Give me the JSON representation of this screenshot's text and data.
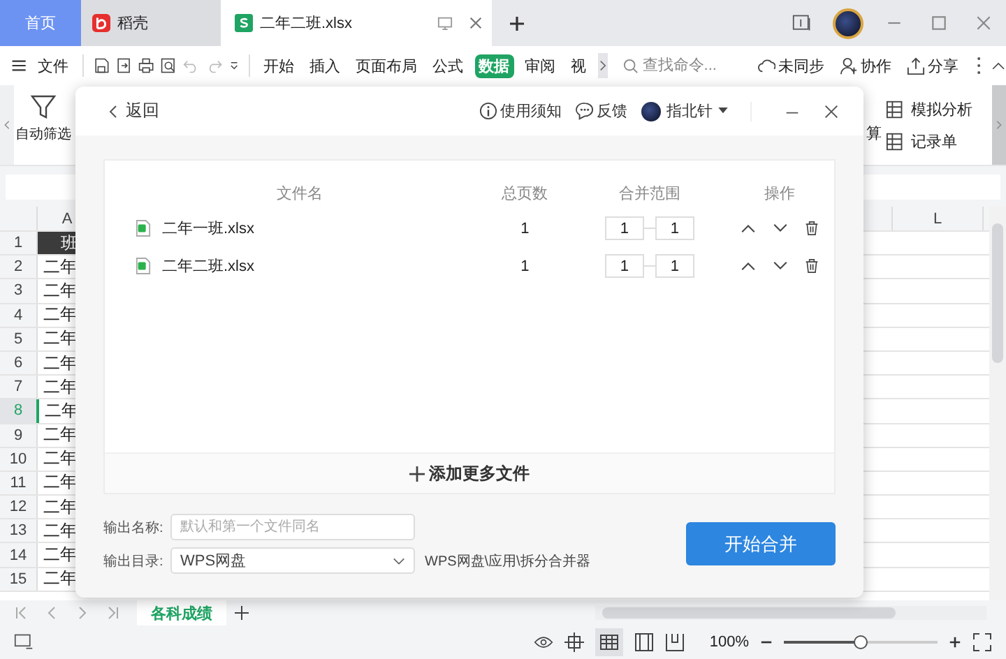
{
  "tabs": [
    {
      "label": "首页",
      "kind": "home",
      "selected": false
    },
    {
      "label": "稻壳",
      "kind": "docer",
      "selected": false
    },
    {
      "label": "二年二班.xlsx",
      "kind": "sheet",
      "selected": true
    }
  ],
  "menu": {
    "file": "文件",
    "tabs": [
      {
        "label": "开始",
        "selected": false
      },
      {
        "label": "插入",
        "selected": false
      },
      {
        "label": "页面布局",
        "selected": false
      },
      {
        "label": "公式",
        "selected": false
      },
      {
        "label": "数据",
        "selected": true
      },
      {
        "label": "审阅",
        "selected": false
      },
      {
        "label": "视",
        "selected": false
      }
    ],
    "search": {
      "placeholder": "查找命令..."
    },
    "actions": [
      {
        "label": "未同步",
        "kind": "cloud"
      },
      {
        "label": "协作",
        "kind": "user"
      },
      {
        "label": "分享",
        "kind": "share"
      }
    ]
  },
  "ribbon": {
    "left": "自动筛选",
    "cut": "算",
    "right": [
      "模拟分析",
      "记录单"
    ]
  },
  "grid": {
    "columns": [
      "A",
      "L"
    ],
    "rows": [
      {
        "number": "1",
        "cell": "班",
        "kind": "header",
        "selected": false
      },
      {
        "number": "2",
        "cell": "二年",
        "kind": "data",
        "selected": false
      },
      {
        "number": "3",
        "cell": "二年",
        "kind": "data",
        "selected": false
      },
      {
        "number": "4",
        "cell": "二年",
        "kind": "data",
        "selected": false
      },
      {
        "number": "5",
        "cell": "二年",
        "kind": "data",
        "selected": false
      },
      {
        "number": "6",
        "cell": "二年",
        "kind": "data",
        "selected": false
      },
      {
        "number": "7",
        "cell": "二年",
        "kind": "data",
        "selected": false
      },
      {
        "number": "8",
        "cell": "二年",
        "kind": "data",
        "selected": true
      },
      {
        "number": "9",
        "cell": "二年",
        "kind": "data",
        "selected": false
      },
      {
        "number": "10",
        "cell": "二年",
        "kind": "data",
        "selected": false
      },
      {
        "number": "11",
        "cell": "二年",
        "kind": "data",
        "selected": false
      },
      {
        "number": "12",
        "cell": "二年",
        "kind": "data",
        "selected": false
      },
      {
        "number": "13",
        "cell": "二年",
        "kind": "data",
        "selected": false
      },
      {
        "number": "14",
        "cell": "二年",
        "kind": "data",
        "selected": false
      },
      {
        "number": "15",
        "cell": "二年",
        "kind": "data",
        "selected": false
      }
    ]
  },
  "sheet_tabs": [
    {
      "label": "各科成绩",
      "selected": true
    }
  ],
  "status": {
    "zoom": "100%",
    "level": 0.5
  },
  "dialog": {
    "back": "返回",
    "help": "使用须知",
    "feedback": "反馈",
    "user": "指北针",
    "columns": [
      "文件名",
      "总页数",
      "合并范围",
      "操作"
    ],
    "files": [
      {
        "name": "二年一班.xlsx",
        "pages": "1",
        "from": "1",
        "to": "1"
      },
      {
        "name": "二年二班.xlsx",
        "pages": "1",
        "from": "1",
        "to": "1"
      }
    ],
    "add": "添加更多文件",
    "output_name": {
      "label": "输出名称:",
      "placeholder": "默认和第一个文件同名"
    },
    "output_dir": {
      "label": "输出目录:",
      "value": "WPS网盘",
      "path": "WPS网盘\\应用\\拆分合并器"
    },
    "submit": "开始合并"
  }
}
